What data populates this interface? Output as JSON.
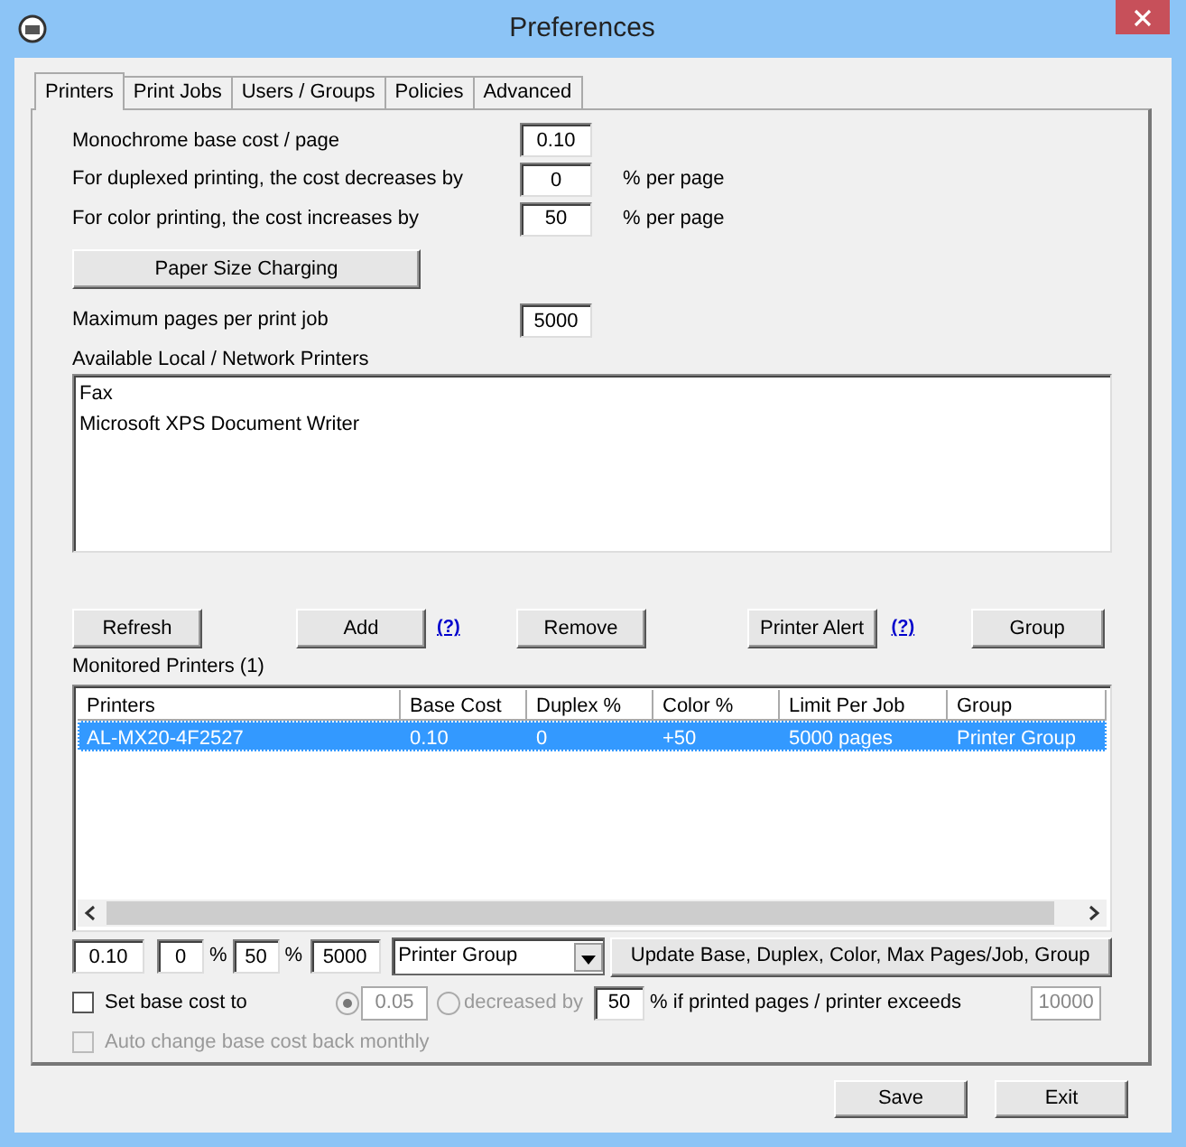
{
  "window": {
    "title": "Preferences"
  },
  "tabs": [
    {
      "label": "Printers",
      "selected": true
    },
    {
      "label": "Print Jobs",
      "selected": false
    },
    {
      "label": "Users / Groups",
      "selected": false
    },
    {
      "label": "Policies",
      "selected": false
    },
    {
      "label": "Advanced",
      "selected": false
    }
  ],
  "cost_settings": [
    {
      "label": "Monochrome base cost / page",
      "value": "0.10"
    },
    {
      "label": "For duplexed printing, the cost decreases by",
      "value": "0",
      "suffix": "% per page"
    },
    {
      "label": "For color printing, the cost increases by",
      "value": "50",
      "suffix": "% per page"
    }
  ],
  "paper_size_button": "Paper Size Charging",
  "max_pages": {
    "label": "Maximum pages per print job",
    "value": "5000"
  },
  "available_printers": {
    "label": "Available Local / Network Printers",
    "items": [
      "Fax",
      "Microsoft XPS Document Writer"
    ]
  },
  "printer_buttons": [
    {
      "kind": "button",
      "label": "Refresh"
    },
    {
      "kind": "button",
      "label": "Add"
    },
    {
      "kind": "help",
      "label": "(?)"
    },
    {
      "kind": "button",
      "label": "Remove"
    },
    {
      "kind": "button",
      "label": "Printer Alert"
    },
    {
      "kind": "help",
      "label": "(?)"
    },
    {
      "kind": "button",
      "label": "Group"
    }
  ],
  "monitored_printers": {
    "label": "Monitored Printers (1)",
    "columns": [
      "Printers",
      "Base Cost",
      "Duplex %",
      "Color %",
      "Limit Per Job",
      "Group"
    ],
    "rows": [
      {
        "cells": [
          "AL-MX20-4F2527",
          "0.10",
          "0",
          "+50",
          "5000 pages",
          "Printer Group"
        ],
        "selected": true
      }
    ]
  },
  "edit_row": {
    "base_cost": "0.10",
    "duplex": "0",
    "duplex_unit": "%",
    "color_increase": "50",
    "color_unit": "%",
    "max_pages": "5000",
    "group": "Printer Group",
    "update_button": "Update Base, Duplex, Color, Max Pages/Job, Group"
  },
  "set_base_cost": {
    "label": "Set base cost to",
    "checked": false,
    "fixed_selected": true,
    "fixed_value": "0.05",
    "decrease_label": "decreased by",
    "decrease_selected": false,
    "options_disabled": true,
    "decrease_value": "50",
    "condition": "% if printed pages / printer exceeds",
    "threshold": "10000"
  },
  "auto_change": {
    "label": "Auto change base cost back monthly",
    "checked": false,
    "disabled": true
  },
  "footer_buttons": [
    "Save",
    "Exit"
  ]
}
